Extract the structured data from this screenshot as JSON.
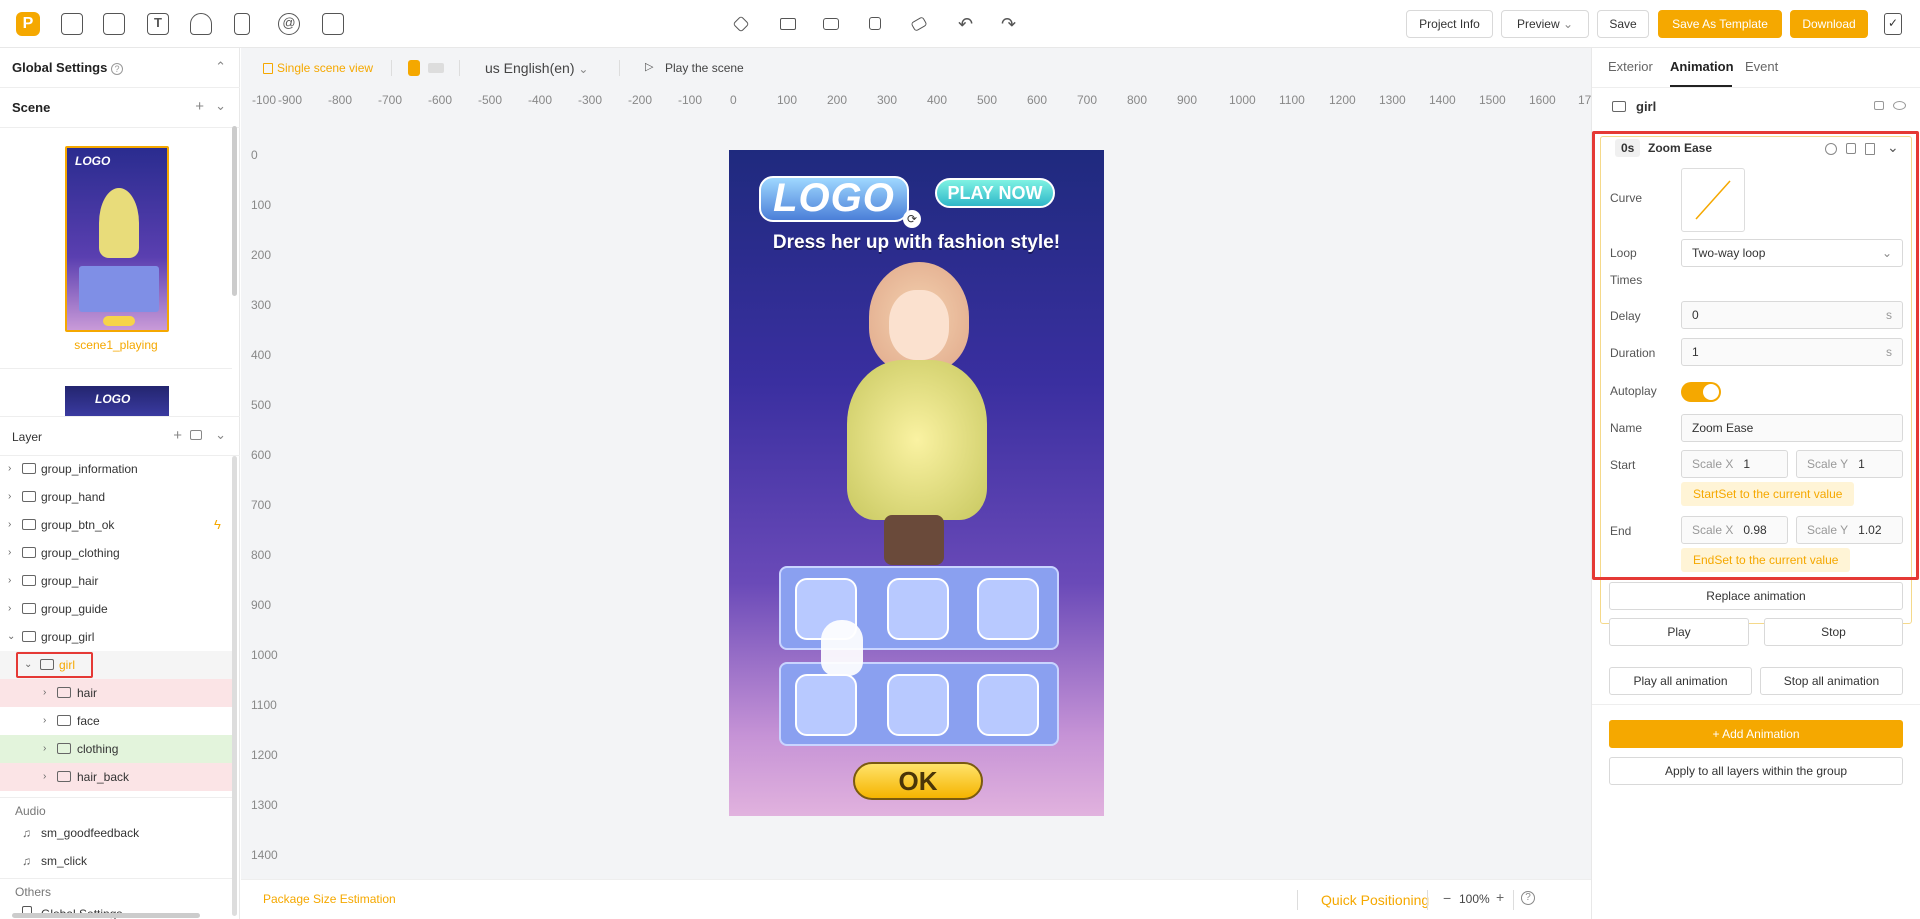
{
  "app": {
    "logo_letter": "P",
    "accent": "#f5a800",
    "highlight": "#e53935"
  },
  "topbar": {
    "left_icons": [
      "inbox-icon",
      "layout-icon",
      "text-icon",
      "hand-icon",
      "file-icon",
      "at-icon",
      "puzzle-icon"
    ],
    "center_icons": [
      "layers-icon",
      "folder-icon",
      "folder-open-icon",
      "copy-icon",
      "eraser-icon",
      "undo-icon",
      "redo-icon"
    ],
    "project_info": "Project Info",
    "preview": "Preview",
    "save": "Save",
    "save_template": "Save As Template",
    "download": "Download"
  },
  "left": {
    "global_settings": "Global Settings",
    "scene_title": "Scene",
    "scene_name": "scene1_playing",
    "layer_title": "Layer",
    "layers": [
      {
        "name": "group_information"
      },
      {
        "name": "group_hand"
      },
      {
        "name": "group_btn_ok"
      },
      {
        "name": "group_clothing"
      },
      {
        "name": "group_hair"
      },
      {
        "name": "group_guide"
      },
      {
        "name": "group_girl"
      },
      {
        "name": "girl"
      },
      {
        "name": "hair"
      },
      {
        "name": "face"
      },
      {
        "name": "clothing"
      },
      {
        "name": "hair_back"
      }
    ],
    "audio_title": "Audio",
    "audio": [
      "sm_goodfeedback",
      "sm_click"
    ],
    "others_title": "Others",
    "others": [
      "Global Settings"
    ]
  },
  "canvas": {
    "single_scene": "Single scene view",
    "language": "us English(en)",
    "play_scene": "Play the scene",
    "ruler_h": [
      "-100",
      "-900",
      "-800",
      "-700",
      "-600",
      "-500",
      "-400",
      "-300",
      "-200",
      "-100",
      "0",
      "100",
      "200",
      "300",
      "400",
      "500",
      "600",
      "700",
      "800",
      "900",
      "1000",
      "1100",
      "1200",
      "1300",
      "1400",
      "1500",
      "1600",
      "17"
    ],
    "ruler_v": [
      "0",
      "100",
      "200",
      "300",
      "400",
      "500",
      "600",
      "700",
      "800",
      "900",
      "1000",
      "1100",
      "1200",
      "1300",
      "1400"
    ],
    "art": {
      "logo": "LOGO",
      "play_now": "PLAY NOW",
      "headline": "Dress her up with fashion style!",
      "ok": "OK"
    },
    "package_size": "Package Size Estimation",
    "quick_positioning": "Quick Positioning",
    "zoom": "100%"
  },
  "right": {
    "tabs": [
      "Exterior",
      "Animation",
      "Event"
    ],
    "active_tab": "Animation",
    "layer_name": "girl",
    "anim": {
      "time": "0s",
      "title": "Zoom Ease",
      "curve_label": "Curve",
      "loop_label": "Loop",
      "loop_value": "Two-way loop",
      "times_label": "Times",
      "delay_label": "Delay",
      "delay_value": "0",
      "delay_unit": "s",
      "duration_label": "Duration",
      "duration_value": "1",
      "duration_unit": "s",
      "autoplay_label": "Autoplay",
      "name_label": "Name",
      "name_value": "Zoom Ease",
      "start_label": "Start",
      "start_scale_x_label": "Scale X",
      "start_scale_x": "1",
      "start_scale_y_label": "Scale Y",
      "start_scale_y": "1",
      "start_set": "StartSet to the current value",
      "end_label": "End",
      "end_scale_x_label": "Scale X",
      "end_scale_x": "0.98",
      "end_scale_y_label": "Scale Y",
      "end_scale_y": "1.02",
      "end_set": "EndSet to the current value"
    },
    "replace_animation": "Replace animation",
    "play": "Play",
    "stop": "Stop",
    "play_all": "Play all animation",
    "stop_all": "Stop all animation",
    "add_animation": "+ Add Animation",
    "apply_all": "Apply to all layers within the group"
  }
}
